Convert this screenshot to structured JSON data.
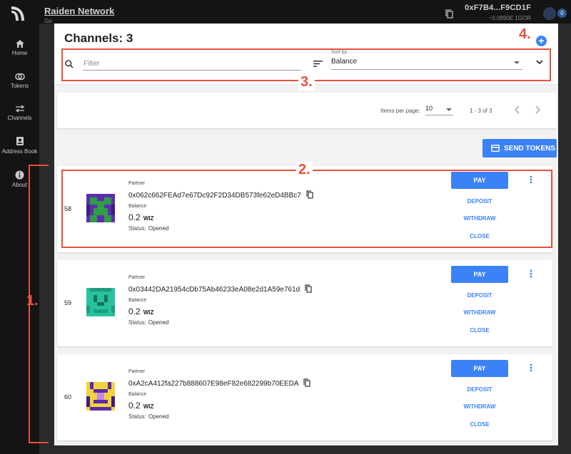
{
  "topbar": {
    "title": "Raiden Network",
    "subtitle": "Go",
    "address": "0xF7B4...F9CD1F",
    "balance": "~0.0990E  1GOR",
    "notifications": "0"
  },
  "sidebar": {
    "items": [
      {
        "label": "Home",
        "icon": "home-icon"
      },
      {
        "label": "Tokens",
        "icon": "tokens-icon"
      },
      {
        "label": "Channels",
        "icon": "channels-icon"
      },
      {
        "label": "Address Book",
        "icon": "address-book-icon"
      },
      {
        "label": "About",
        "icon": "info-icon"
      }
    ]
  },
  "dialog": {
    "title": "Channels: 3",
    "filter_placeholder": "Filter",
    "sort_label": "Sort by",
    "sort_value": "Balance",
    "items_per_page_label": "Items per page:",
    "items_per_page": "10",
    "range": "1 - 3 of 3",
    "send_tokens": "SEND TOKENS"
  },
  "channels": [
    {
      "id": "58",
      "partner_label": "Partner",
      "partner": "0x062c662FEAd7e67Dc92F2D34DB573fe62eD4BBc7",
      "balance_label": "Balance",
      "balance": "0.2",
      "token": "WIZ",
      "status_label": "Status:",
      "status": "Opened"
    },
    {
      "id": "59",
      "partner_label": "Partner",
      "partner": "0x03442DA21954cDb75Ab46233eA08e2d1A59e761d",
      "balance_label": "Balance",
      "balance": "0.2",
      "token": "WIZ",
      "status_label": "Status:",
      "status": "Opened"
    },
    {
      "id": "60",
      "partner_label": "Partner",
      "partner": "0xA2cA412fa227b888607E98eF82e682299b70EEDA",
      "balance_label": "Balance",
      "balance": "0.2",
      "token": "WIZ",
      "status_label": "Status:",
      "status": "Opened"
    }
  ],
  "actions": {
    "pay": "PAY",
    "deposit": "DEPOSIT",
    "withdraw": "WITHDRAW",
    "close": "CLOSE"
  },
  "annotations": {
    "one": "1.",
    "two": "2.",
    "three": "3.",
    "four": "4."
  },
  "colors": {
    "accent": "#3b82f6",
    "annotation": "#e8513c",
    "nav_bg": "#141414"
  }
}
